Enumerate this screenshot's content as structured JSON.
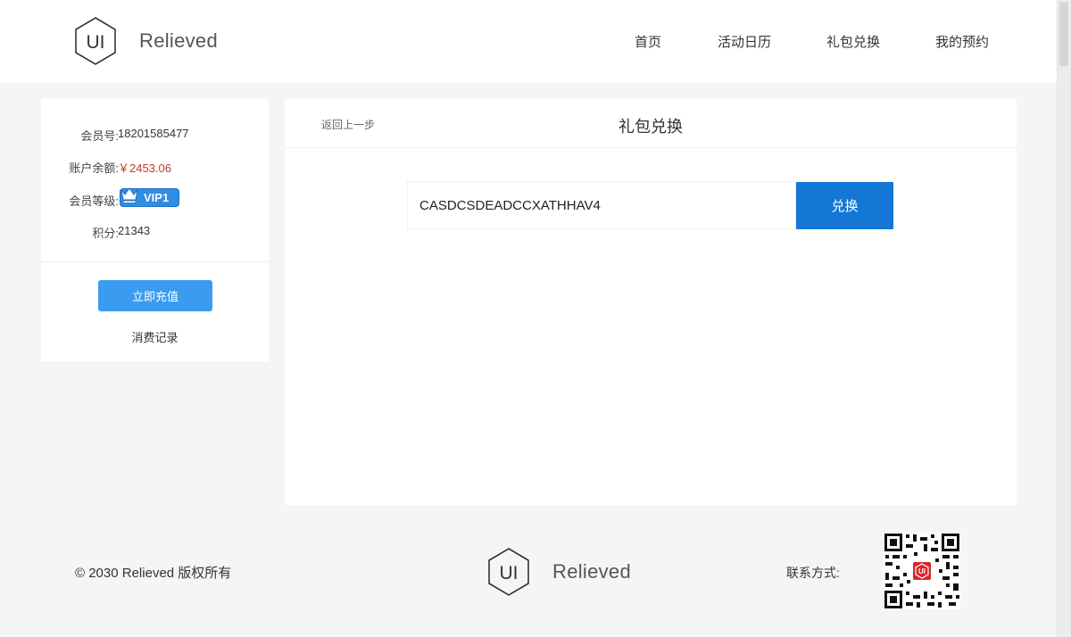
{
  "brand": {
    "logo_mark": "UI",
    "name": "Relieved"
  },
  "nav": {
    "items": [
      {
        "label": "首页"
      },
      {
        "label": "活动日历"
      },
      {
        "label": "礼包兑换"
      },
      {
        "label": "我的预约"
      }
    ]
  },
  "account": {
    "member_id_label": "会员号:",
    "member_id": "18201585477",
    "balance_label": "账户余额:",
    "balance": "￥2453.06",
    "level_label": "会员等级:",
    "level": "VIP1",
    "points_label": "积分:",
    "points": "21343",
    "recharge_button": "立即充值",
    "records_link": "消费记录"
  },
  "redeem": {
    "back_link": "返回上一步",
    "title": "礼包兑换",
    "code_value": "CASDCSDEADCCXATHHAV4",
    "button": "兑换"
  },
  "footer": {
    "copyright": "© 2030 Relieved 版权所有",
    "contact_label": "联系方式:",
    "qr_center_mark": "UI"
  },
  "colors": {
    "accent_blue": "#1477d6",
    "recharge_blue": "#3a9cf0",
    "balance_red": "#c0392b",
    "vip_blue": "#2f8de4"
  },
  "icons": {
    "logo": "hexagon-ui-logo-icon",
    "vip": "crown-icon",
    "qr": "qr-code-icon"
  }
}
